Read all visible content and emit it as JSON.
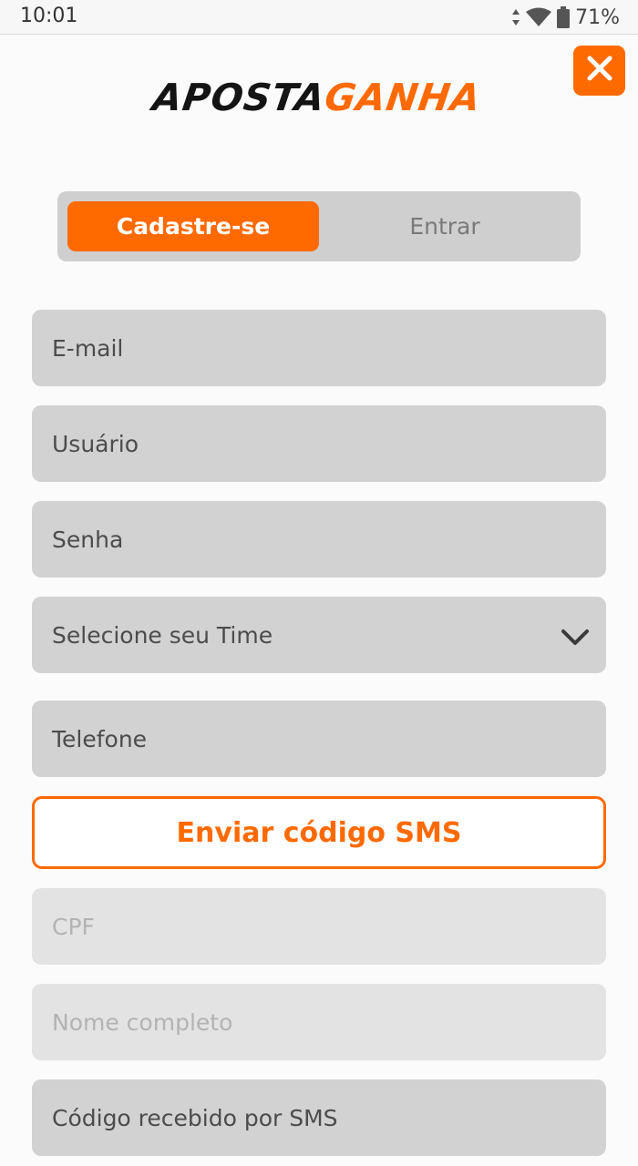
{
  "status_bar": {
    "time": "10:01",
    "battery_percent": "71%",
    "icons": [
      "data-arrows-icon",
      "wifi-icon",
      "battery-icon"
    ]
  },
  "header": {
    "logo_part1": "APOSTA",
    "logo_part2": "GANHA",
    "close_icon": "close-icon"
  },
  "tabs": {
    "signup_label": "Cadastre-se",
    "login_label": "Entrar",
    "active": "Cadastre-se"
  },
  "form": {
    "email": {
      "value": "",
      "placeholder": "E-mail"
    },
    "username": {
      "value": "",
      "placeholder": "Usuário"
    },
    "password": {
      "value": "",
      "placeholder": "Senha"
    },
    "team_select": {
      "selected": "Selecione seu Time",
      "icon": "chevron-down-icon"
    },
    "phone": {
      "value": "",
      "placeholder": "Telefone"
    },
    "send_sms_label": "Enviar código SMS",
    "cpf": {
      "value": "",
      "placeholder": "CPF"
    },
    "full_name": {
      "value": "",
      "placeholder": "Nome completo"
    },
    "sms_code": {
      "value": "",
      "placeholder": "Código recebido por SMS"
    }
  },
  "colors": {
    "accent": "#ff6a00",
    "field_bg": "#d2d2d2",
    "field_disabled_bg": "#e3e3e3",
    "tab_track": "#cfcfcf"
  }
}
